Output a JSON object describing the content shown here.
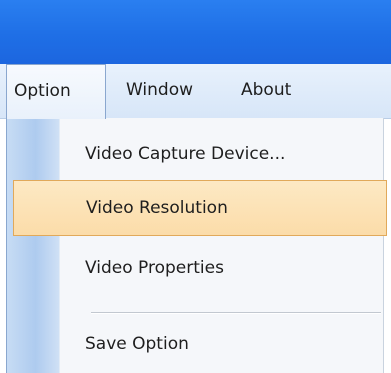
{
  "menubar": {
    "items": [
      {
        "label": "Option"
      },
      {
        "label": "Window"
      },
      {
        "label": "About"
      }
    ]
  },
  "dropdown": {
    "items": [
      {
        "label": "Video Capture Device..."
      },
      {
        "label": "Video Resolution",
        "highlighted": true
      },
      {
        "label": "Video Properties"
      },
      {
        "label": "Save Option"
      }
    ]
  },
  "colors": {
    "titlebar": "#1f6fe6",
    "menubar": "#dce9f9",
    "highlight": "#fbdca9",
    "highlight_border": "#e1a95a"
  }
}
